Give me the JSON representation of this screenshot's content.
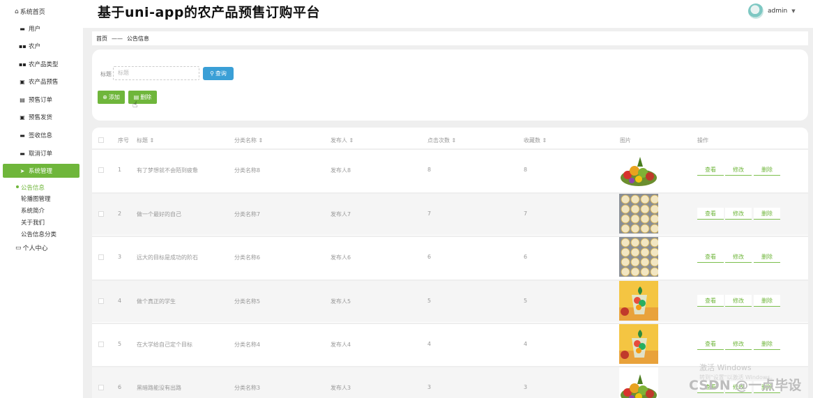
{
  "app": {
    "title": "基于uni-app的农产品预售订购平台"
  },
  "user": {
    "name": "admin"
  },
  "sidebar": {
    "home": "系统首页",
    "items": [
      {
        "label": "用户",
        "icon": "monitor-icon"
      },
      {
        "label": "农户",
        "icon": "grid-icon"
      },
      {
        "label": "农产品类型",
        "icon": "grid-icon"
      },
      {
        "label": "农产品预售",
        "icon": "clipboard-icon"
      },
      {
        "label": "预售订单",
        "icon": "chart-icon"
      },
      {
        "label": "预售发货",
        "icon": "clipboard-icon"
      },
      {
        "label": "签收信息",
        "icon": "monitor-icon"
      },
      {
        "label": "取消订单",
        "icon": "printer-icon"
      },
      {
        "label": "系统管理",
        "icon": "send-icon"
      }
    ],
    "sub_items": [
      "公告信息",
      "轮播图管理",
      "系统简介",
      "关于我们",
      "公告信息分类"
    ],
    "personal": "个人中心"
  },
  "breadcrumb": {
    "home": "首页",
    "sep": "——",
    "current": "公告信息"
  },
  "search": {
    "label": "标题",
    "placeholder": "标题",
    "button": "查询"
  },
  "actions": {
    "add": "添加",
    "delete": "删除"
  },
  "table": {
    "headers": {
      "index": "序号",
      "title": "标题 ⇕",
      "category": "分类名称 ⇕",
      "publisher": "发布人 ⇕",
      "clicks": "点击次数 ⇕",
      "favorites": "收藏数 ⇕",
      "image": "图片",
      "ops": "操作"
    },
    "rows": [
      {
        "index": "1",
        "title": "有了梦想就不会陌到疲惫",
        "category": "分类名称8",
        "publisher": "发布人8",
        "clicks": "8",
        "favorites": "8",
        "image": "fruit-basket"
      },
      {
        "index": "2",
        "title": "做一个最好的自己",
        "category": "分类名称7",
        "publisher": "发布人7",
        "clicks": "7",
        "favorites": "7",
        "image": "egg-grid"
      },
      {
        "index": "3",
        "title": "远大的目标是成功的阶石",
        "category": "分类名称6",
        "publisher": "发布人6",
        "clicks": "6",
        "favorites": "6",
        "image": "egg-grid"
      },
      {
        "index": "4",
        "title": "做个真正的学生",
        "category": "分类名称5",
        "publisher": "发布人5",
        "clicks": "5",
        "favorites": "5",
        "image": "fruit-cup"
      },
      {
        "index": "5",
        "title": "在大学给自己定个目标",
        "category": "分类名称4",
        "publisher": "发布人4",
        "clicks": "4",
        "favorites": "4",
        "image": "fruit-cup"
      },
      {
        "index": "6",
        "title": "黑暗路能没有出路",
        "category": "分类名称3",
        "publisher": "发布人3",
        "clicks": "3",
        "favorites": "3",
        "image": "fruit-basket"
      }
    ],
    "row_actions": {
      "view": "查看",
      "edit": "修改",
      "delete": "删除"
    }
  },
  "overlay": {
    "activate": "激活 Windows",
    "activate_sub": "转到\"设置\"以激活 Windows。",
    "csdn": "CSDN @一点毕设"
  },
  "colors": {
    "accent": "#6fb63b",
    "search_button": "#3a9fd6",
    "panel_bg": "#efefef"
  }
}
